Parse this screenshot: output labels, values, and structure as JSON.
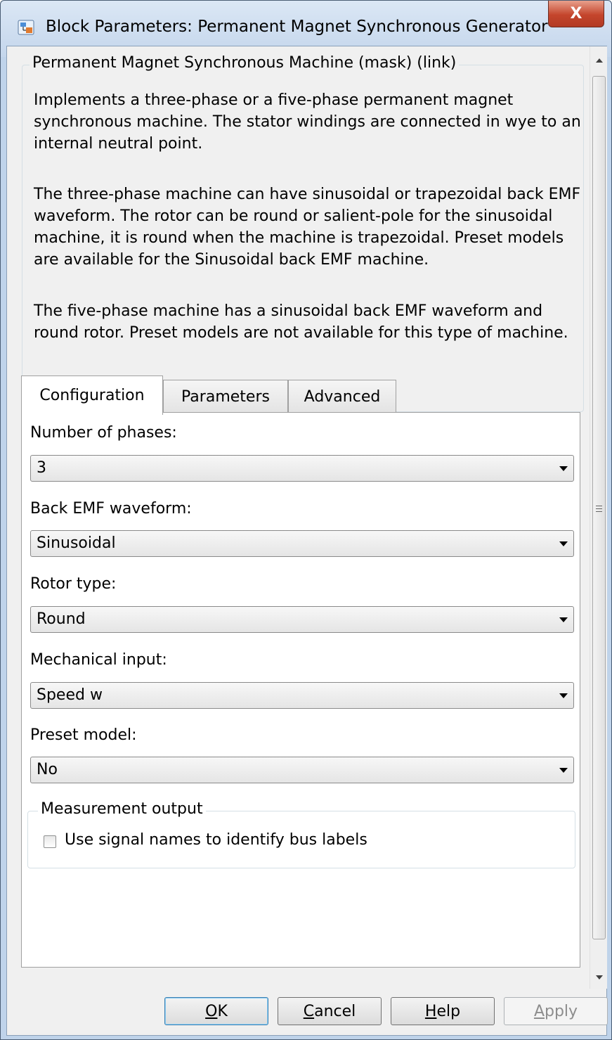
{
  "window": {
    "title": "Block Parameters: Permanent Magnet Synchronous Generator",
    "close_glyph": "X"
  },
  "description": {
    "group_title": "Permanent Magnet Synchronous Machine (mask) (link)",
    "paragraphs": [
      "Implements a three-phase or a five-phase permanent magnet synchronous machine. The stator windings are connected in wye to an internal neutral point.",
      "The three-phase machine can have sinusoidal or trapezoidal back EMF waveform. The rotor can be round or salient-pole for the sinusoidal machine, it is round when the machine is trapezoidal. Preset models are available for the Sinusoidal back EMF machine.",
      "The five-phase machine has a sinusoidal back EMF waveform and round rotor. Preset models are not available for this type of machine."
    ]
  },
  "tabs": [
    {
      "label": "Configuration",
      "active": true
    },
    {
      "label": "Parameters",
      "active": false
    },
    {
      "label": "Advanced",
      "active": false
    }
  ],
  "config": {
    "fields": [
      {
        "label": "Number of phases:",
        "value": "3"
      },
      {
        "label": "Back EMF waveform:",
        "value": "Sinusoidal"
      },
      {
        "label": "Rotor type:",
        "value": "Round"
      },
      {
        "label": "Mechanical input:",
        "value": "Speed w"
      },
      {
        "label": "Preset model:",
        "value": "No"
      }
    ],
    "measurement": {
      "group_title": "Measurement output",
      "checkbox_label": "Use signal names to identify bus labels",
      "checked": false
    }
  },
  "buttons": {
    "ok": {
      "mnemonic": "O",
      "rest": "K"
    },
    "cancel": {
      "mnemonic": "C",
      "rest": "ancel"
    },
    "help": {
      "mnemonic": "H",
      "rest": "elp"
    },
    "apply": {
      "mnemonic": "A",
      "rest": "pply"
    }
  },
  "icons": {
    "app": "simulink-block-icon",
    "close": "close-icon",
    "scroll_up": "arrow-up-icon",
    "scroll_down": "arrow-down-icon",
    "dropdown": "chevron-down-icon"
  },
  "colors": {
    "title_bar": "#c4d6ec",
    "close_button": "#c4452c",
    "client_bg": "#f0f0f0",
    "default_button_border": "#3c7fb1"
  }
}
